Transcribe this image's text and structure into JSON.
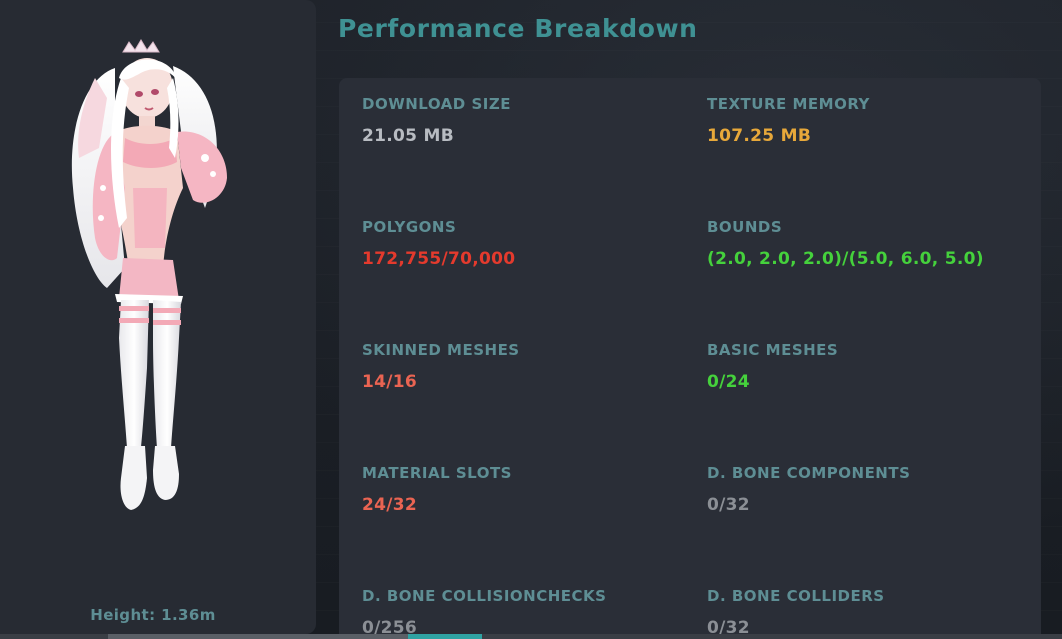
{
  "page": {
    "title": "Performance Breakdown"
  },
  "avatar": {
    "height_text": "Height: 1.36m"
  },
  "stats": [
    {
      "label": "DOWNLOAD SIZE",
      "value": "21.05 MB",
      "status_color": "#b8bcc2"
    },
    {
      "label": "TEXTURE MEMORY",
      "value": "107.25 MB",
      "status_color": "#e7a83a"
    },
    {
      "label": "POLYGONS",
      "value": "172,755/70,000",
      "status_color": "#e43a2d"
    },
    {
      "label": "BOUNDS",
      "value": "(2.0, 2.0, 2.0)/(5.0, 6.0, 5.0)",
      "status_color": "#45d13c"
    },
    {
      "label": "SKINNED MESHES",
      "value": "14/16",
      "status_color": "#ea6452"
    },
    {
      "label": "BASIC MESHES",
      "value": "0/24",
      "status_color": "#45d13c"
    },
    {
      "label": "MATERIAL SLOTS",
      "value": "24/32",
      "status_color": "#ea6452"
    },
    {
      "label": "D. BONE COMPONENTS",
      "value": "0/32",
      "status_color": "#8b8f95"
    },
    {
      "label": "D. BONE COLLISIONCHECKS",
      "value": "0/256",
      "status_color": "#8b8f95"
    },
    {
      "label": "D. BONE COLLIDERS",
      "value": "0/32",
      "status_color": "#8b8f95"
    }
  ],
  "colors": {
    "accent_teal": "#3f9193",
    "label_teal": "#5e8e94",
    "panel_bg": "#272b33",
    "card_bg": "#2a2e37"
  },
  "icons": {
    "avatar_preview": "avatar-figure"
  }
}
